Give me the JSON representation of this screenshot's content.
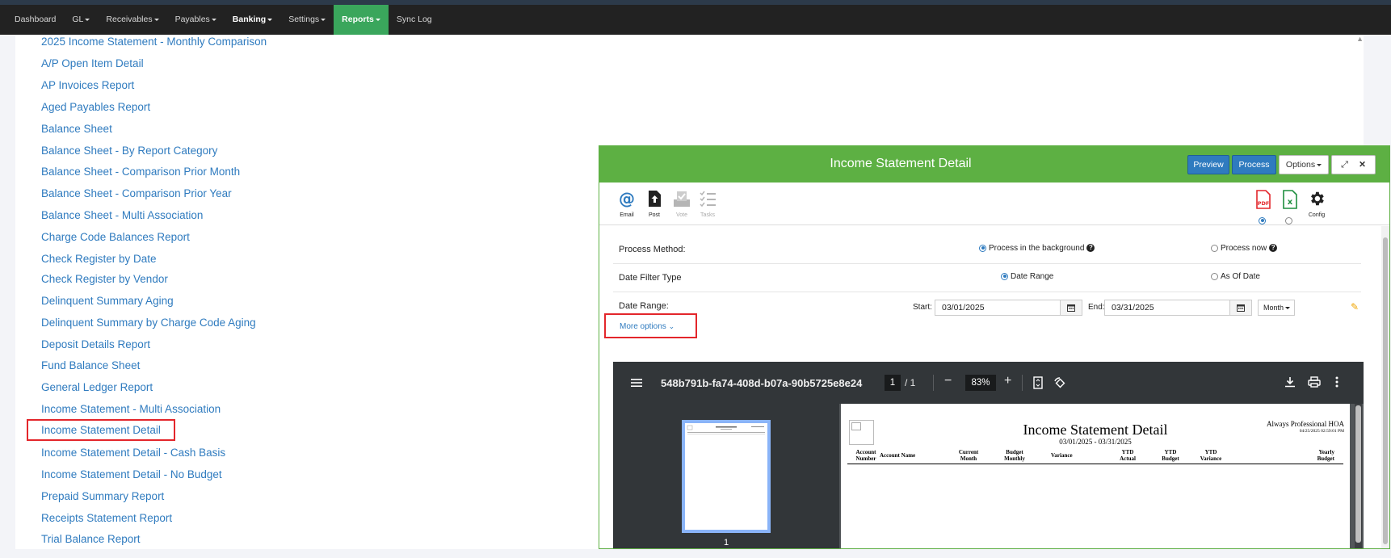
{
  "nav": {
    "items": [
      {
        "label": "Dashboard",
        "dropdown": false
      },
      {
        "label": "GL",
        "dropdown": true
      },
      {
        "label": "Receivables",
        "dropdown": true
      },
      {
        "label": "Payables",
        "dropdown": true
      },
      {
        "label": "Banking",
        "dropdown": true
      },
      {
        "label": "Settings",
        "dropdown": true
      },
      {
        "label": "Reports",
        "dropdown": true
      },
      {
        "label": "Sync Log",
        "dropdown": false
      }
    ],
    "active": "Reports",
    "bold": "Banking"
  },
  "reports": [
    "2025 Income Statement - Monthly Comparison",
    "A/P Open Item Detail",
    "AP Invoices Report",
    "Aged Payables Report",
    "Balance Sheet",
    "Balance Sheet - By Report Category",
    "Balance Sheet - Comparison Prior Month",
    "Balance Sheet - Comparison Prior Year",
    "Balance Sheet - Multi Association",
    "Charge Code Balances Report",
    "Check Register by Date",
    "Check Register by Vendor",
    "Delinquent Summary Aging",
    "Delinquent Summary by Charge Code Aging",
    "Deposit Details Report",
    "Fund Balance Sheet",
    "General Ledger Report",
    "Income Statement - Multi Association",
    "Income Statement Detail",
    "Income Statement Detail - Cash Basis",
    "Income Statement Detail - No Budget",
    "Prepaid Summary Report",
    "Receipts Statement Report",
    "Trial Balance Report"
  ],
  "highlighted_report": "Income Statement Detail",
  "modal": {
    "title": "Income Statement Detail",
    "buttons": {
      "preview": "Preview",
      "process": "Process",
      "options": "Options",
      "close": "✕"
    },
    "tools": {
      "email": "Email",
      "post": "Post",
      "vote": "Vote",
      "tasks": "Tasks",
      "config": "Config"
    },
    "output_formats": {
      "pdf": "PDF",
      "excel": "x",
      "selected": "pdf"
    },
    "process_method": {
      "label": "Process Method:",
      "opt1": "Process in the background",
      "opt2": "Process now",
      "selected": "Process in the background"
    },
    "date_filter_type": {
      "label": "Date Filter Type",
      "opt1": "Date Range",
      "opt2": "As Of Date",
      "selected": "Date Range"
    },
    "date_range": {
      "label": "Date Range:",
      "start_label": "Start:",
      "start": "03/01/2025",
      "end_label": "End:",
      "end": "03/31/2025",
      "period": "Month"
    },
    "more_options": "More options"
  },
  "pdf_viewer": {
    "filename": "548b791b-fa74-408d-b07a-90b5725e8e24",
    "page": "1",
    "total_pages": "/ 1",
    "zoom": "83%",
    "thumb_page": "1",
    "document": {
      "title": "Income Statement Detail",
      "subtitle": "03/01/2025 - 03/31/2025",
      "company": "Always Professional HOA",
      "timestamp": "04/25/2025 02:59:01 PM",
      "columns": [
        {
          "l1": "Account",
          "l2": "Number"
        },
        {
          "l1": "Account Name",
          "l2": ""
        },
        {
          "l1": "Current",
          "l2": "Month"
        },
        {
          "l1": "Budget",
          "l2": "Monthly"
        },
        {
          "l1": "Variance",
          "l2": ""
        },
        {
          "l1": "YTD",
          "l2": "Actual"
        },
        {
          "l1": "YTD",
          "l2": "Budget"
        },
        {
          "l1": "YTD",
          "l2": "Variance"
        },
        {
          "l1": "Yearly",
          "l2": "Budget"
        }
      ]
    }
  },
  "colors": {
    "nav_bg": "#222222",
    "active_tab": "#3aa65c",
    "link": "#2f7bbf",
    "modal_header": "#5db043",
    "highlight_box": "#e3262b"
  }
}
